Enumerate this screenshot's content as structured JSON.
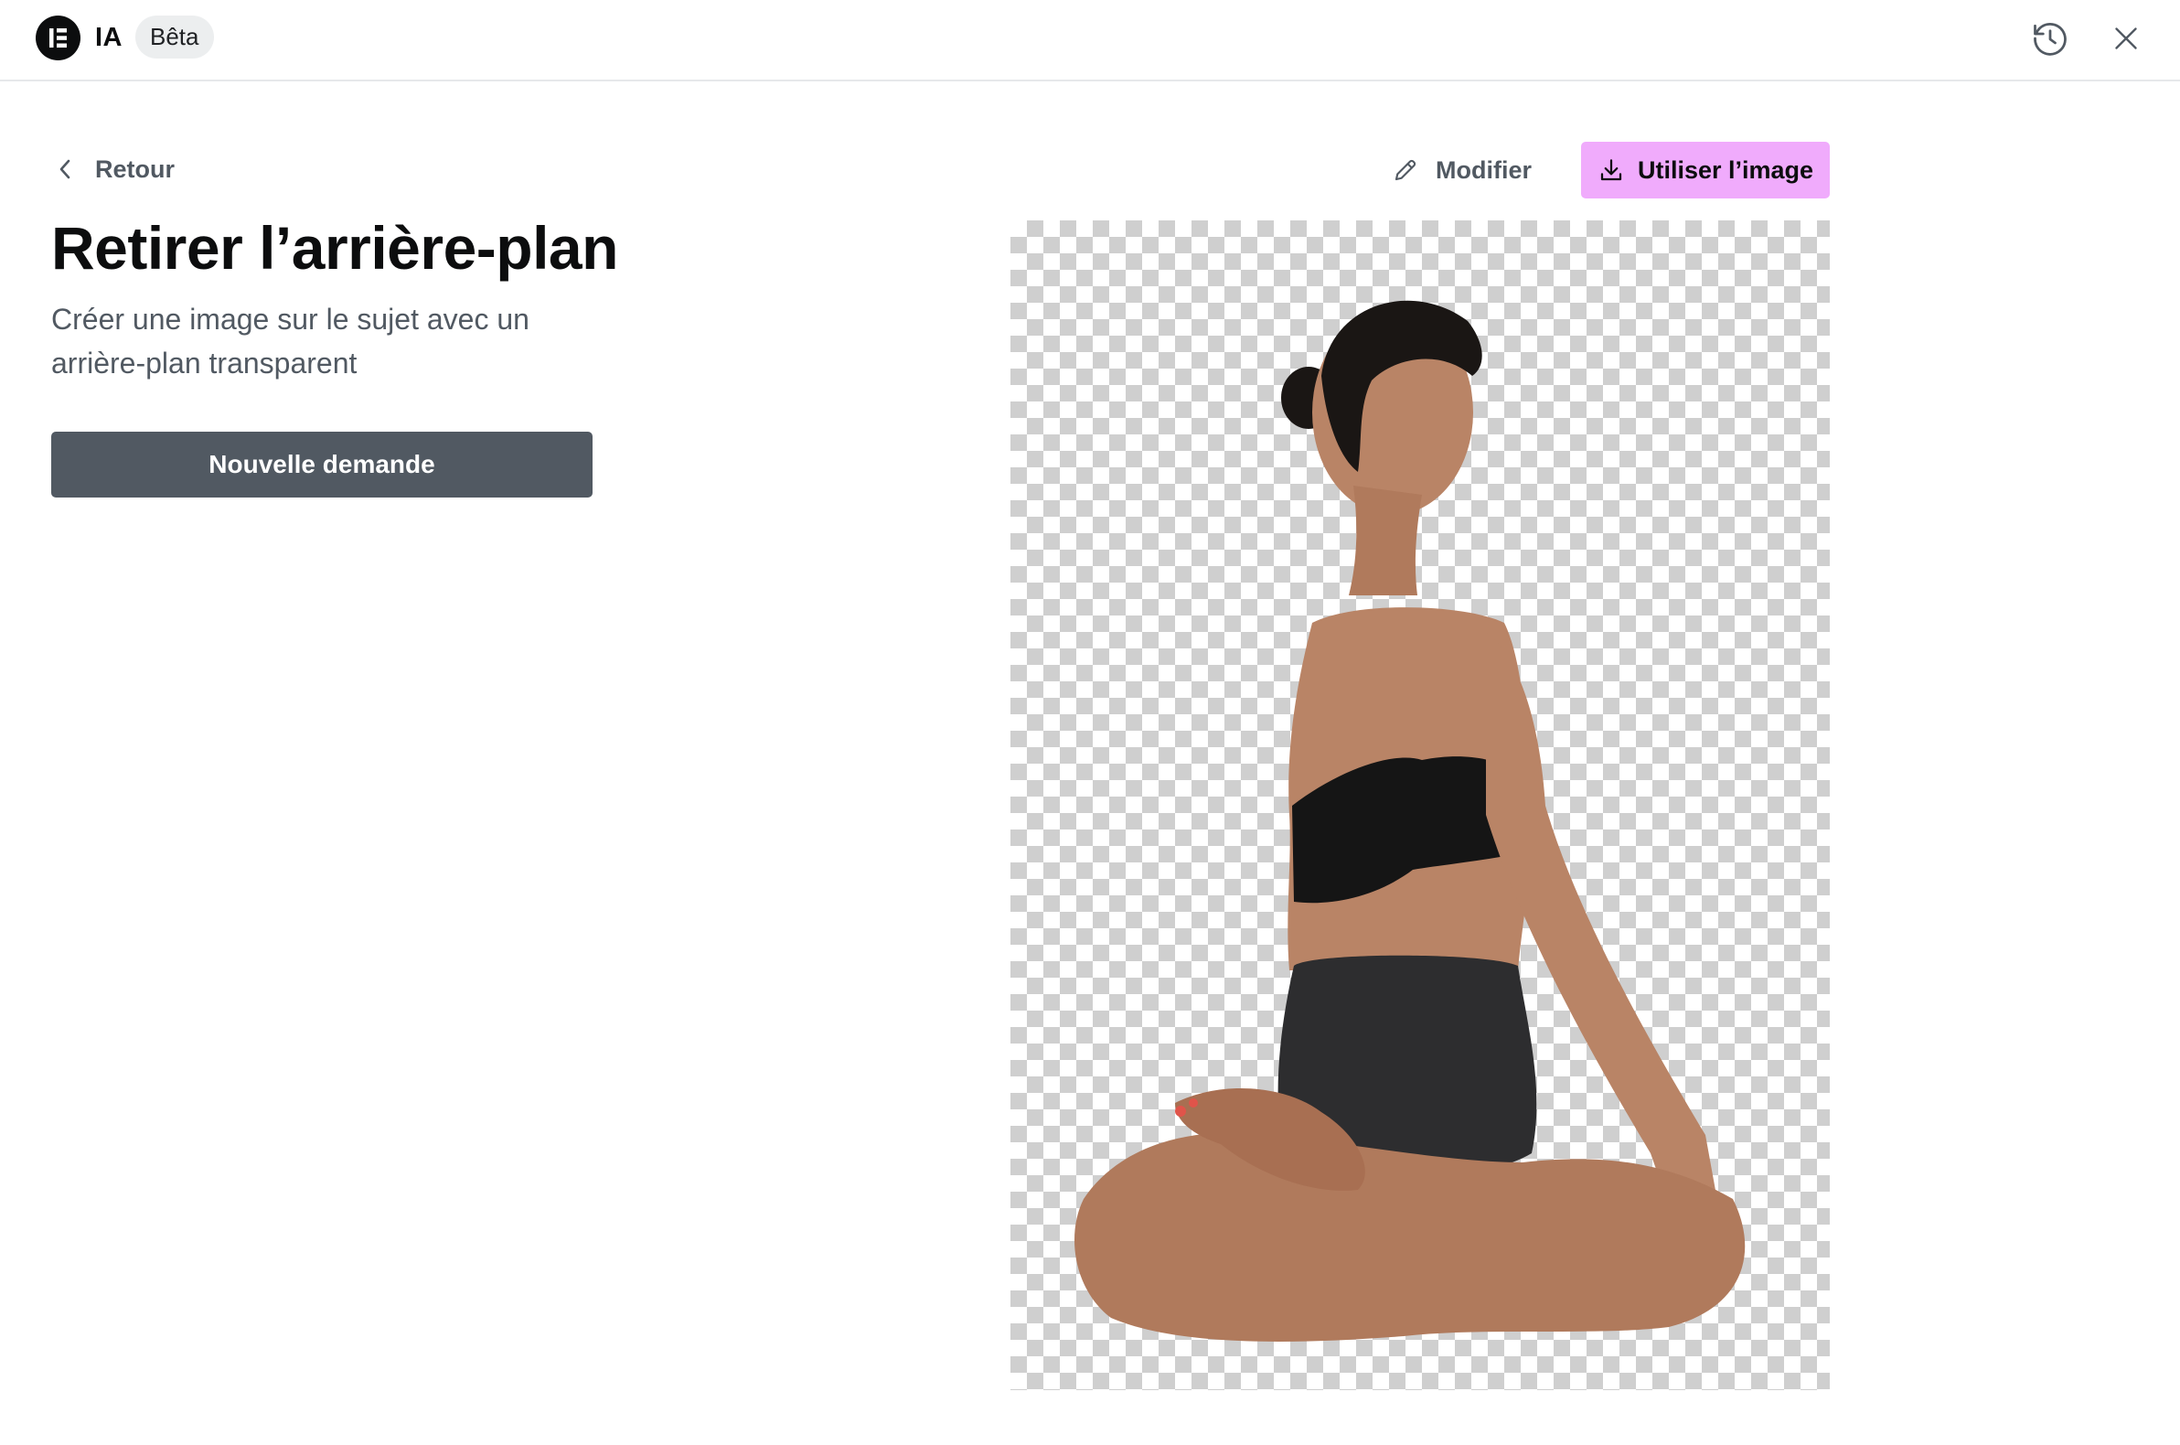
{
  "header": {
    "app_name": "IA",
    "badge": "Bêta",
    "logo_icon": "elementor-logo-icon",
    "history_icon": "history-icon",
    "close_icon": "close-icon"
  },
  "left_panel": {
    "back_label": "Retour",
    "title": "Retirer l’arrière-plan",
    "subtitle": "Créer une image sur le sujet avec un arrière-plan transparent",
    "new_request_label": "Nouvelle demande"
  },
  "actions": {
    "edit_label": "Modifier",
    "use_image_label": "Utiliser l’image"
  },
  "preview": {
    "subject": "woman seated cross-legged in yoga pose, background removed",
    "background": "transparent checkerboard"
  },
  "colors": {
    "accent": "#f0abfc",
    "primary_button": "#515962",
    "text_primary": "#0c0d0e",
    "text_secondary": "#515962"
  }
}
